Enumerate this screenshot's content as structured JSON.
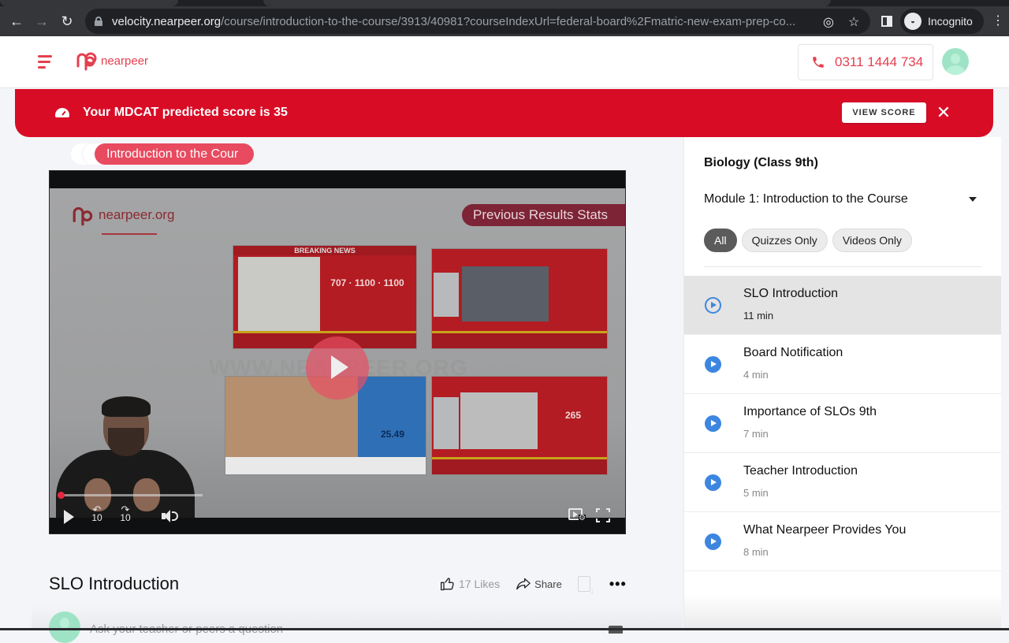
{
  "browser": {
    "url_host": "velocity.nearpeer.org",
    "url_path": "/course/introduction-to-the-course/3913/40981?courseIndexUrl=federal-board%2Fmatric-new-exam-prep-co...",
    "profile_label": "Incognito"
  },
  "header": {
    "logo_text": "nearpeer",
    "phone": "0311 1444 734",
    "brand_color": "#e4404f"
  },
  "banner": {
    "message": "Your MDCAT predicted score is 35",
    "button_label": "VIEW SCORE",
    "close_glyph": "✕",
    "color": "#d90c26"
  },
  "breadcrumb": {
    "label": "Introduction to the Cour"
  },
  "video": {
    "frame_logo_text": "nearpeer.org",
    "frame_pill_text": "Previous Results Stats",
    "watermark": "WWW.NEARPEER.ORG",
    "news_header": "BREAKING NEWS",
    "news_caption_1": "707 · 1100 · 1100",
    "news_caption_2": "265",
    "news_caption_3": "25.49",
    "progress_fraction": 0.0,
    "skip_back_label": "10",
    "skip_forward_label": "10"
  },
  "lesson": {
    "title": "SLO Introduction",
    "likes": "17 Likes",
    "share_label": "Share",
    "more_glyph": "•••",
    "comment_placeholder": "Ask your teacher or peers a question"
  },
  "sidebar": {
    "course_title": "Biology (Class 9th)",
    "module_label": "Module 1: Introduction to the Course",
    "filters": [
      "All",
      "Quizzes Only",
      "Videos Only"
    ],
    "active_filter": "All",
    "lessons": [
      {
        "title": "SLO Introduction",
        "duration": "11 min",
        "current": true
      },
      {
        "title": "Board Notification",
        "duration": "4 min",
        "current": false
      },
      {
        "title": "Importance of SLOs 9th",
        "duration": "7 min",
        "current": false
      },
      {
        "title": "Teacher Introduction",
        "duration": "5 min",
        "current": false
      },
      {
        "title": "What Nearpeer Provides You",
        "duration": "8 min",
        "current": false
      }
    ]
  }
}
